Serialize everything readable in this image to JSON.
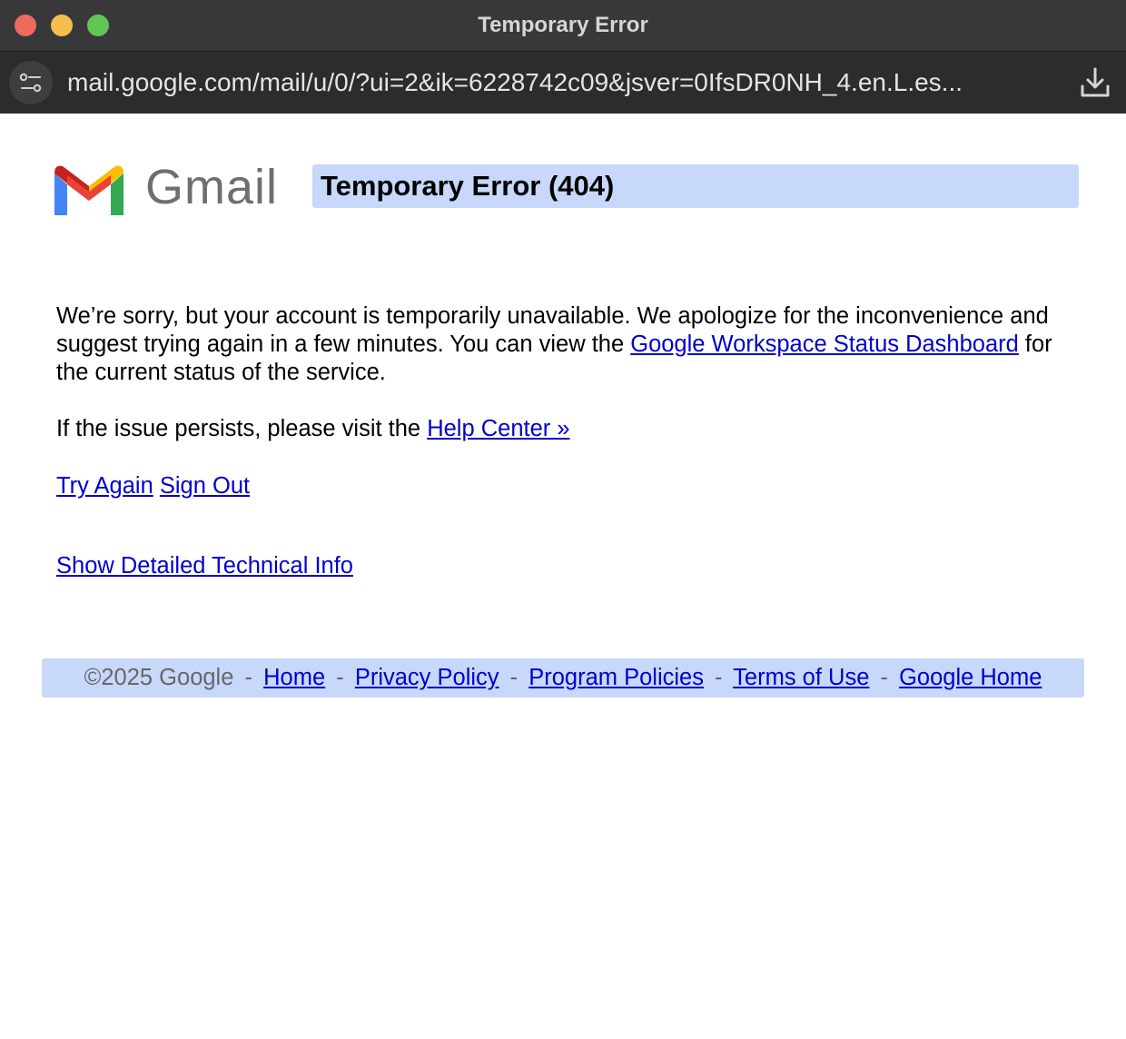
{
  "window": {
    "title": "Temporary Error"
  },
  "urlbar": {
    "url": "mail.google.com/mail/u/0/?ui=2&ik=6228742c09&jsver=0IfsDR0NH_4.en.L.es..."
  },
  "logo": {
    "text": "Gmail"
  },
  "error": {
    "title": "Temporary Error (404)",
    "message_part1": "We’re sorry, but your account is temporarily unavailable. We apologize for the inconvenience and suggest trying again in a few minutes. You can view the ",
    "status_link": "Google Workspace Status Dashboard",
    "message_part2": " for the current status of the service.",
    "help_prefix": "If the issue persists, please visit the ",
    "help_link": "Help Center »",
    "try_again": "Try Again",
    "sign_out": "Sign Out",
    "technical_info": "Show Detailed Technical Info"
  },
  "footer": {
    "copyright": "©2025 Google",
    "separator": "-",
    "links": [
      "Home",
      "Privacy Policy",
      "Program Policies",
      "Terms of Use",
      "Google Home"
    ]
  },
  "colors": {
    "header_bg": "#c7d8fb",
    "link": "#0000cc",
    "titlebar": "#38383b",
    "urlbar": "#2c2c2e"
  },
  "icons": {
    "site_settings": "site-settings-icon",
    "download": "download-icon",
    "logo": "gmail-logo-icon"
  }
}
